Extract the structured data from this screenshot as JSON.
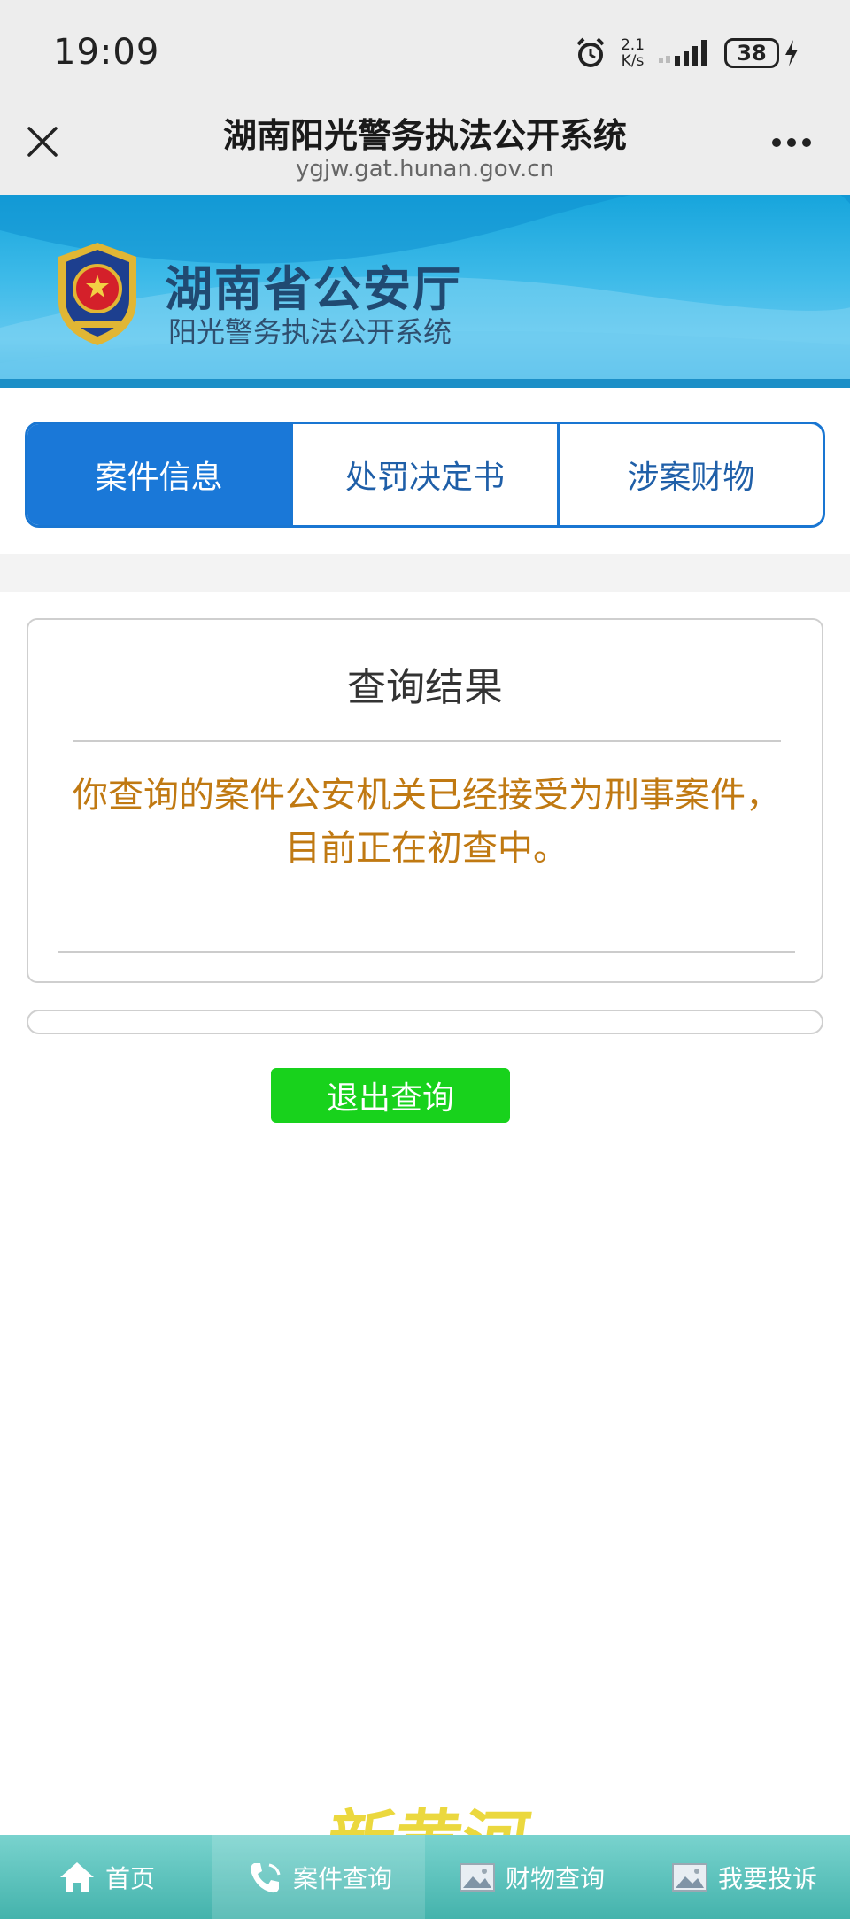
{
  "status_bar": {
    "time": "19:09",
    "net_speed_value": "2.1",
    "net_speed_unit": "K/s",
    "battery": "38"
  },
  "title_bar": {
    "title": "湖南阳光警务执法公开系统",
    "url": "ygjw.gat.hunan.gov.cn"
  },
  "banner": {
    "title": "湖南省公安厅",
    "subtitle": "阳光警务执法公开系统"
  },
  "tabs": [
    {
      "label": "案件信息",
      "active": true
    },
    {
      "label": "处罚决定书",
      "active": false
    },
    {
      "label": "涉案财物",
      "active": false
    }
  ],
  "result": {
    "title": "查询结果",
    "message": "你查询的案件公安机关已经接受为刑事案件，目前正在初查中。"
  },
  "exit_button": "退出查询",
  "watermark_text": "新黄河",
  "bottom_nav": [
    {
      "label": "首页",
      "icon": "home-icon"
    },
    {
      "label": "案件查询",
      "icon": "phone-icon",
      "active": true
    },
    {
      "label": "财物查询",
      "icon": "image-icon"
    },
    {
      "label": "我要投诉",
      "icon": "image-icon"
    }
  ],
  "colors": {
    "tab_active": "#1a78d8",
    "message": "#c07912",
    "exit_button": "#18d21c",
    "nav_bg": "#44b3ac"
  }
}
